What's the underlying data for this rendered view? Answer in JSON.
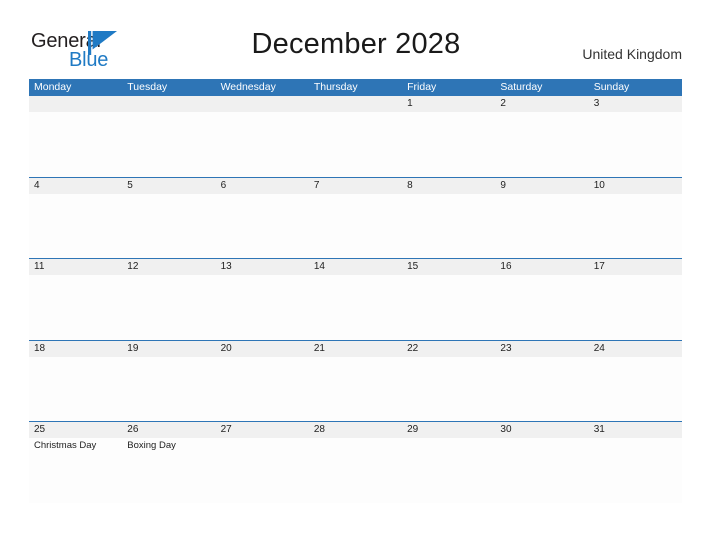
{
  "brand": {
    "name_part1": "General",
    "name_part2": "Blue",
    "mark_icon": "blue-flag-triangle-icon",
    "accent_color": "#1f7ac4"
  },
  "header": {
    "title": "December 2028",
    "region": "United Kingdom"
  },
  "calendar": {
    "header_bg_color": "#2e75b6",
    "date_strip_color": "#f0f0f0",
    "weekday_headers": [
      "Monday",
      "Tuesday",
      "Wednesday",
      "Thursday",
      "Friday",
      "Saturday",
      "Sunday"
    ],
    "weeks": [
      {
        "days": [
          {
            "date": "",
            "events": []
          },
          {
            "date": "",
            "events": []
          },
          {
            "date": "",
            "events": []
          },
          {
            "date": "",
            "events": []
          },
          {
            "date": "1",
            "events": []
          },
          {
            "date": "2",
            "events": []
          },
          {
            "date": "3",
            "events": []
          }
        ]
      },
      {
        "days": [
          {
            "date": "4",
            "events": []
          },
          {
            "date": "5",
            "events": []
          },
          {
            "date": "6",
            "events": []
          },
          {
            "date": "7",
            "events": []
          },
          {
            "date": "8",
            "events": []
          },
          {
            "date": "9",
            "events": []
          },
          {
            "date": "10",
            "events": []
          }
        ]
      },
      {
        "days": [
          {
            "date": "11",
            "events": []
          },
          {
            "date": "12",
            "events": []
          },
          {
            "date": "13",
            "events": []
          },
          {
            "date": "14",
            "events": []
          },
          {
            "date": "15",
            "events": []
          },
          {
            "date": "16",
            "events": []
          },
          {
            "date": "17",
            "events": []
          }
        ]
      },
      {
        "days": [
          {
            "date": "18",
            "events": []
          },
          {
            "date": "19",
            "events": []
          },
          {
            "date": "20",
            "events": []
          },
          {
            "date": "21",
            "events": []
          },
          {
            "date": "22",
            "events": []
          },
          {
            "date": "23",
            "events": []
          },
          {
            "date": "24",
            "events": []
          }
        ]
      },
      {
        "days": [
          {
            "date": "25",
            "events": [
              "Christmas Day"
            ]
          },
          {
            "date": "26",
            "events": [
              "Boxing Day"
            ]
          },
          {
            "date": "27",
            "events": []
          },
          {
            "date": "28",
            "events": []
          },
          {
            "date": "29",
            "events": []
          },
          {
            "date": "30",
            "events": []
          },
          {
            "date": "31",
            "events": []
          }
        ]
      }
    ]
  }
}
